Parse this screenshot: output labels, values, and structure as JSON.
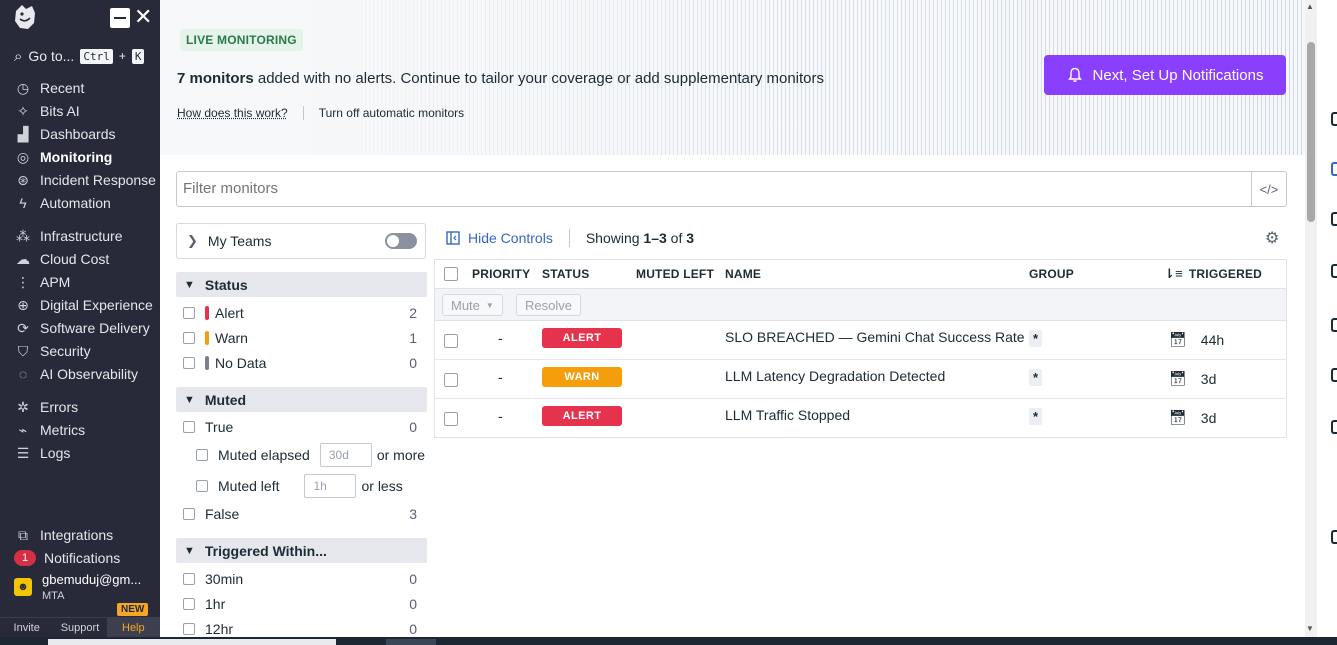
{
  "sidebar": {
    "goto_label": "Go to...",
    "goto_keys": [
      "Ctrl",
      "+",
      "K"
    ],
    "items": [
      {
        "label": "Recent",
        "icon": "clock-icon",
        "active": false
      },
      {
        "label": "Bits AI",
        "icon": "sparkle-icon",
        "active": false
      },
      {
        "label": "Dashboards",
        "icon": "chart-icon",
        "active": false
      },
      {
        "label": "Monitoring",
        "icon": "radar-icon",
        "active": true
      },
      {
        "label": "Incident Response",
        "icon": "siren-icon",
        "active": false
      },
      {
        "label": "Automation",
        "icon": "bolt-icon",
        "active": false
      },
      {
        "label": "Infrastructure",
        "icon": "nodes-icon",
        "active": false
      },
      {
        "label": "Cloud Cost",
        "icon": "cloud-icon",
        "active": false
      },
      {
        "label": "APM",
        "icon": "trace-icon",
        "active": false
      },
      {
        "label": "Digital Experience",
        "icon": "globe-icon",
        "active": false
      },
      {
        "label": "Software Delivery",
        "icon": "pipeline-icon",
        "active": false
      },
      {
        "label": "Security",
        "icon": "shield-icon",
        "active": false
      },
      {
        "label": "AI Observability",
        "icon": "ai-icon",
        "active": false
      },
      {
        "label": "Errors",
        "icon": "bug-icon",
        "active": false
      },
      {
        "label": "Metrics",
        "icon": "metrics-icon",
        "active": false
      },
      {
        "label": "Logs",
        "icon": "logs-icon",
        "active": false
      },
      {
        "label": "Integrations",
        "icon": "puzzle-icon",
        "active": false
      },
      {
        "label": "Notifications",
        "icon": "bell-icon",
        "active": false
      }
    ],
    "notifications_count": "1",
    "user_name": "gbemuduj@gm...",
    "user_org": "MTA",
    "bottom": {
      "invite": "Invite",
      "support": "Support",
      "help": "Help",
      "new_badge": "NEW"
    }
  },
  "banner": {
    "label": "LIVE MONITORING",
    "message_count": "7 monitors",
    "message_rest": " added with no alerts. Continue to tailor your coverage or add supplementary monitors",
    "link_how": "How does this work?",
    "link_turn_off": "Turn off automatic monitors",
    "cta": "Next, Set Up Notifications"
  },
  "filter": {
    "placeholder": "Filter monitors"
  },
  "facets": {
    "my_teams": "My Teams",
    "status": {
      "title": "Status",
      "items": [
        {
          "label": "Alert",
          "count": "2",
          "color": "#e5334d"
        },
        {
          "label": "Warn",
          "count": "1",
          "color": "#f59e0b"
        },
        {
          "label": "No Data",
          "count": "0",
          "color": "#7b7f95"
        }
      ]
    },
    "muted": {
      "title": "Muted",
      "true_label": "True",
      "true_count": "0",
      "elapsed_label": "Muted elapsed",
      "elapsed_placeholder": "30d",
      "elapsed_suffix": "or more",
      "left_label": "Muted left",
      "left_placeholder": "1h",
      "left_suffix": "or less",
      "false_label": "False",
      "false_count": "3"
    },
    "triggered": {
      "title": "Triggered Within...",
      "items": [
        {
          "label": "30min",
          "count": "0"
        },
        {
          "label": "1hr",
          "count": "0"
        },
        {
          "label": "12hr",
          "count": "0"
        }
      ]
    }
  },
  "table": {
    "hide_controls": "Hide Controls",
    "showing_prefix": "Showing ",
    "showing_range": "1–3",
    "showing_of": " of ",
    "showing_total": "3",
    "headers": {
      "priority": "PRIORITY",
      "status": "STATUS",
      "muted_left": "MUTED LEFT",
      "name": "NAME",
      "group": "GROUP",
      "triggered": "TRIGGERED"
    },
    "bulk": {
      "mute": "Mute",
      "resolve": "Resolve"
    },
    "rows": [
      {
        "priority": "-",
        "status": "ALERT",
        "status_color": "#e5334d",
        "name": "SLO BREACHED — Gemini Chat Success Rate",
        "group": "*",
        "triggered": "44h"
      },
      {
        "priority": "-",
        "status": "WARN",
        "status_color": "#f59e0b",
        "name": "LLM Latency Degradation Detected",
        "group": "*",
        "triggered": "3d"
      },
      {
        "priority": "-",
        "status": "ALERT",
        "status_color": "#e5334d",
        "name": "LLM Traffic Stopped",
        "group": "*",
        "triggered": "3d"
      }
    ]
  }
}
